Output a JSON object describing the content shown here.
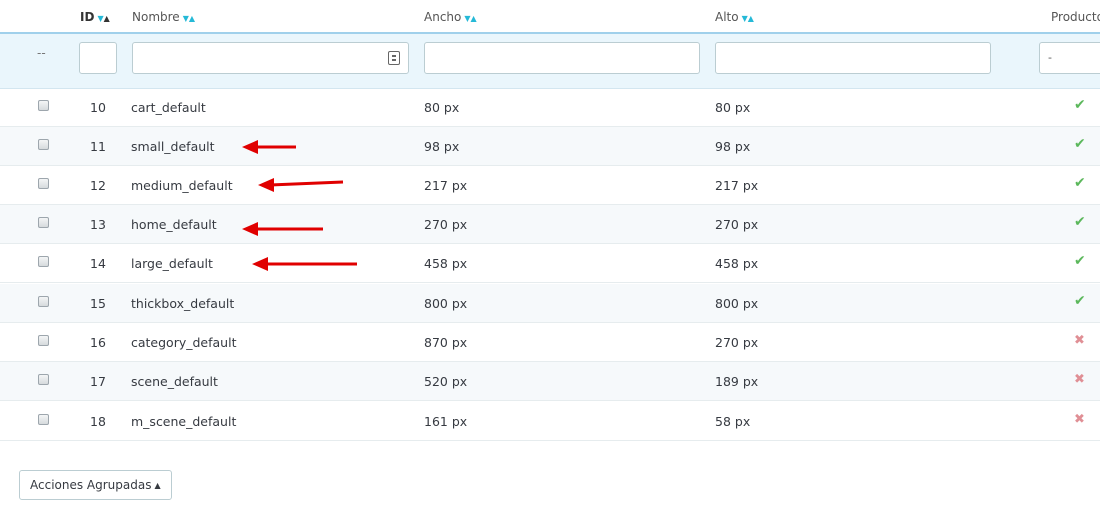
{
  "header": {
    "id_label": "ID",
    "name_label": "Nombre",
    "width_label": "Ancho",
    "height_label": "Alto",
    "products_label": "Producto",
    "sort_down": "▼",
    "sort_up": "▲"
  },
  "filter": {
    "dash": "--",
    "select_value": "-"
  },
  "rows": [
    {
      "id": "10",
      "name": "cart_default",
      "width": "80 px",
      "height": "80 px",
      "products": true
    },
    {
      "id": "11",
      "name": "small_default",
      "width": "98 px",
      "height": "98 px",
      "products": true
    },
    {
      "id": "12",
      "name": "medium_default",
      "width": "217 px",
      "height": "217 px",
      "products": true
    },
    {
      "id": "13",
      "name": "home_default",
      "width": "270 px",
      "height": "270 px",
      "products": true
    },
    {
      "id": "14",
      "name": "large_default",
      "width": "458 px",
      "height": "458 px",
      "products": true
    },
    {
      "id": "15",
      "name": "thickbox_default",
      "width": "800 px",
      "height": "800 px",
      "products": true
    },
    {
      "id": "16",
      "name": "category_default",
      "width": "870 px",
      "height": "270 px",
      "products": false
    },
    {
      "id": "17",
      "name": "scene_default",
      "width": "520 px",
      "height": "189 px",
      "products": false
    },
    {
      "id": "18",
      "name": "m_scene_default",
      "width": "161 px",
      "height": "58 px",
      "products": false
    }
  ],
  "status_icons": {
    "enabled": "✔",
    "disabled": "✖"
  },
  "bulk_actions": {
    "label": "Acciones Agrupadas",
    "caret": "▲"
  },
  "colors": {
    "accent": "#25b9d7",
    "check_green": "#5cb85c",
    "cross_red": "#e08f95",
    "arrow_red": "#e00000",
    "filter_bg": "#eaf6fc"
  }
}
